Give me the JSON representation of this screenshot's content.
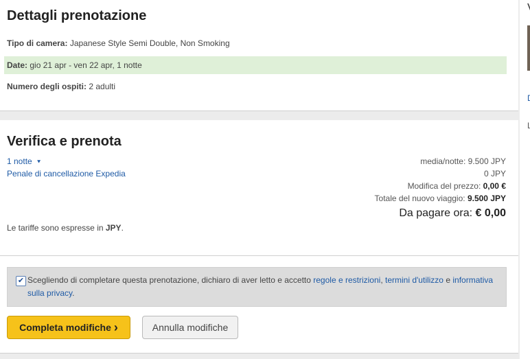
{
  "booking": {
    "title": "Dettagli prenotazione",
    "room_label": "Tipo di camera:",
    "room_value": "Japanese Style Semi Double, Non Smoking",
    "date_label": "Date:",
    "date_value": "gio 21 apr - ven 22 apr, 1 notte",
    "guests_label": "Numero degli ospiti:",
    "guests_value": "2 adulti"
  },
  "verify": {
    "title": "Verifica e prenota",
    "nights_link": "1 notte",
    "penalty_link": "Penale di cancellazione Expedia",
    "avg_night": "media/notte: 9.500 JPY",
    "penalty_value": "0 JPY",
    "price_change_label": "Modifica del prezzo:",
    "price_change_value": "0,00 €",
    "new_total_label": "Totale del nuovo viaggio:",
    "new_total_value": "9.500 JPY",
    "pay_now_label": "Da pagare ora:",
    "pay_now_value": "€ 0,00",
    "currency_note_prefix": "Le tariffe sono espresse in",
    "currency_code": "JPY",
    "currency_note_suffix": "."
  },
  "consent": {
    "checked": true,
    "text": "Scegliendo di completare questa prenotazione, dichiaro di aver letto e accetto",
    "rules_link": "regole e restrizioni",
    "comma": ",",
    "terms_link": "termini d'utilizzo",
    "and": "e",
    "privacy_link": "informativa sulla privacy",
    "period": "."
  },
  "actions": {
    "complete_label": "Completa modifiche",
    "complete_chevron": "›",
    "cancel_label": "Annulla modifiche"
  },
  "edge": {
    "v": "V",
    "d": "D",
    "l": "L"
  },
  "colors": {
    "accent_link": "#1e5aa5",
    "primary_button": "#f6c21a",
    "date_highlight": "#dff0d8"
  }
}
